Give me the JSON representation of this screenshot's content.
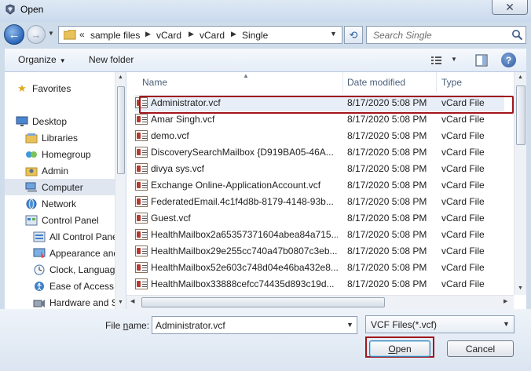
{
  "window": {
    "title": "Open",
    "close_glyph": "✕",
    "icon": "app-icon"
  },
  "nav": {
    "back_glyph": "←",
    "forward_glyph": "→",
    "breadcrumb_overflow": "«",
    "breadcrumbs": [
      "sample files",
      "vCard",
      "vCard",
      "Single"
    ],
    "search_placeholder": "Search Single",
    "refresh_glyph": "⟲"
  },
  "toolbar": {
    "organize": "Organize",
    "new_folder": "New folder",
    "help_glyph": "?"
  },
  "sidebar": {
    "items": [
      {
        "label": "Favorites",
        "icon": "star-icon"
      },
      {
        "label": "Desktop",
        "icon": "desktop-icon"
      },
      {
        "label": "Libraries",
        "icon": "libraries-icon"
      },
      {
        "label": "Homegroup",
        "icon": "homegroup-icon"
      },
      {
        "label": "Admin",
        "icon": "user-folder-icon"
      },
      {
        "label": "Computer",
        "icon": "computer-icon",
        "selected": true
      },
      {
        "label": "Network",
        "icon": "network-icon"
      },
      {
        "label": "Control Panel",
        "icon": "control-panel-icon"
      },
      {
        "label": "All Control Panel Items",
        "icon": "control-panel-icon"
      },
      {
        "label": "Appearance and Personalization",
        "icon": "appearance-icon"
      },
      {
        "label": "Clock, Language, and Region",
        "icon": "clock-icon"
      },
      {
        "label": "Ease of Access",
        "icon": "ease-of-access-icon"
      },
      {
        "label": "Hardware and Sound",
        "icon": "hardware-icon"
      }
    ]
  },
  "files": {
    "columns": [
      "Name",
      "Date modified",
      "Type"
    ],
    "rows": [
      {
        "name": "Administrator.vcf",
        "date": "8/17/2020 5:08 PM",
        "type": "vCard File",
        "selected": true
      },
      {
        "name": "Amar Singh.vcf",
        "date": "8/17/2020 5:08 PM",
        "type": "vCard File"
      },
      {
        "name": "demo.vcf",
        "date": "8/17/2020 5:08 PM",
        "type": "vCard File"
      },
      {
        "name": "DiscoverySearchMailbox {D919BA05-46A...",
        "date": "8/17/2020 5:08 PM",
        "type": "vCard File"
      },
      {
        "name": "divya sys.vcf",
        "date": "8/17/2020 5:08 PM",
        "type": "vCard File"
      },
      {
        "name": "Exchange Online-ApplicationAccount.vcf",
        "date": "8/17/2020 5:08 PM",
        "type": "vCard File"
      },
      {
        "name": "FederatedEmail.4c1f4d8b-8179-4148-93b...",
        "date": "8/17/2020 5:08 PM",
        "type": "vCard File"
      },
      {
        "name": "Guest.vcf",
        "date": "8/17/2020 5:08 PM",
        "type": "vCard File"
      },
      {
        "name": "HealthMailbox2a65357371604abea84a715...",
        "date": "8/17/2020 5:08 PM",
        "type": "vCard File"
      },
      {
        "name": "HealthMailbox29e255cc740a47b0807c3eb...",
        "date": "8/17/2020 5:08 PM",
        "type": "vCard File"
      },
      {
        "name": "HealthMailbox52e603c748d04e46ba432e8...",
        "date": "8/17/2020 5:08 PM",
        "type": "vCard File"
      },
      {
        "name": "HealthMailbox33888cefcc74435d893c19d...",
        "date": "8/17/2020 5:08 PM",
        "type": "vCard File"
      }
    ]
  },
  "footer": {
    "file_name_label": "File name:",
    "file_name_value": "Administrator.vcf",
    "filter_value": "VCF Files(*.vcf)",
    "open_label": "Open",
    "cancel_label": "Cancel"
  },
  "colors": {
    "highlight": "#a1161c",
    "chrome": "#cfdcea",
    "accent": "#2a66b8"
  }
}
